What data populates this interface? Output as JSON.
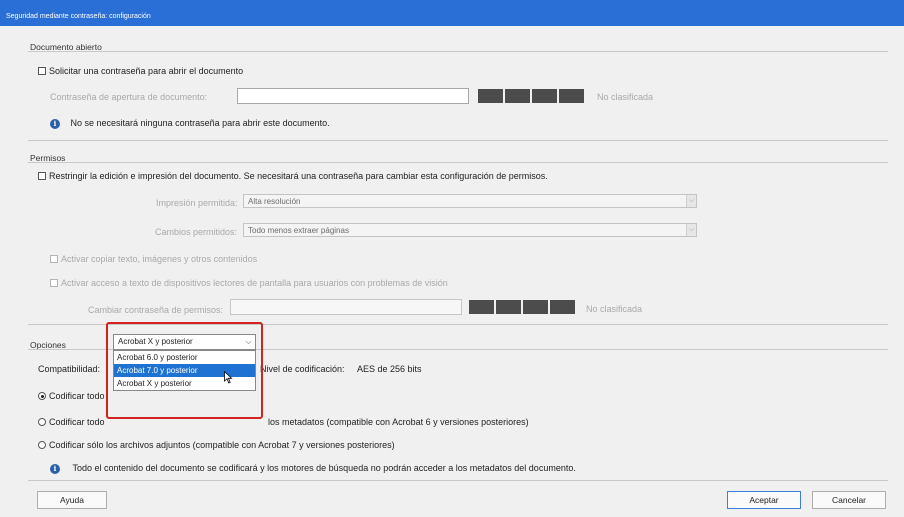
{
  "window": {
    "title": "Seguridad mediante contraseña: configuración"
  },
  "open_doc": {
    "legend": "Documento abierto",
    "require_password_label": "Solicitar una contraseña para abrir el documento",
    "password_label": "Contraseña de apertura de documento:",
    "password_value": "",
    "strength_text": "No clasificada",
    "info_text": "No se necesitará ninguna contraseña para abrir este documento."
  },
  "permissions": {
    "legend": "Permisos",
    "restrict_label": "Restringir la edición e impresión del documento. Se necesitará una contraseña para cambiar esta configuración de permisos.",
    "printing_label": "Impresión permitida:",
    "printing_value": "Alta resolución",
    "changes_label": "Cambios permitidos:",
    "changes_value": "Todo menos extraer páginas",
    "copy_label": "Activar copiar texto, imágenes y otros contenidos",
    "screen_reader_label": "Activar acceso a texto de dispositivos lectores de pantalla para usuarios con problemas de visión",
    "change_password_label": "Cambiar contraseña de permisos:",
    "change_password_value": "",
    "strength_text": "No clasificada"
  },
  "options": {
    "legend": "Opciones",
    "compat_label": "Compatibilidad:",
    "compat_value": "Acrobat X y posterior",
    "compat_options": [
      "Acrobat 6.0 y posterior",
      "Acrobat 7.0 y posterior",
      "Acrobat X y posterior"
    ],
    "compat_highlighted": "Acrobat 7.0 y posterior",
    "encryption_level_label": "Nivel de codificación:",
    "encryption_level_value": "AES de 256 bits",
    "radio_all_visible": "Codificar todo",
    "radio_except_metadata_left": "Codificar todo",
    "radio_except_metadata_right": "los metadatos (compatible con Acrobat 6 y versiones posteriores)",
    "radio_attachments": "Codificar sólo los archivos adjuntos (compatible con Acrobat 7 y versiones posteriores)",
    "info_text": "Todo el contenido del documento se codificará y los motores de búsqueda no podrán acceder a los metadatos del documento."
  },
  "buttons": {
    "help": "Ayuda",
    "ok": "Aceptar",
    "cancel": "Cancelar"
  },
  "colors": {
    "titlebar": "#2a6fd6",
    "highlight": "#1e73d2",
    "annotation_outline": "#d22323",
    "info_icon": "#2b5fa8"
  },
  "icons": {
    "info": "info-icon",
    "dropdown": "chevron-down-icon",
    "cursor": "mouse-pointer-icon"
  }
}
